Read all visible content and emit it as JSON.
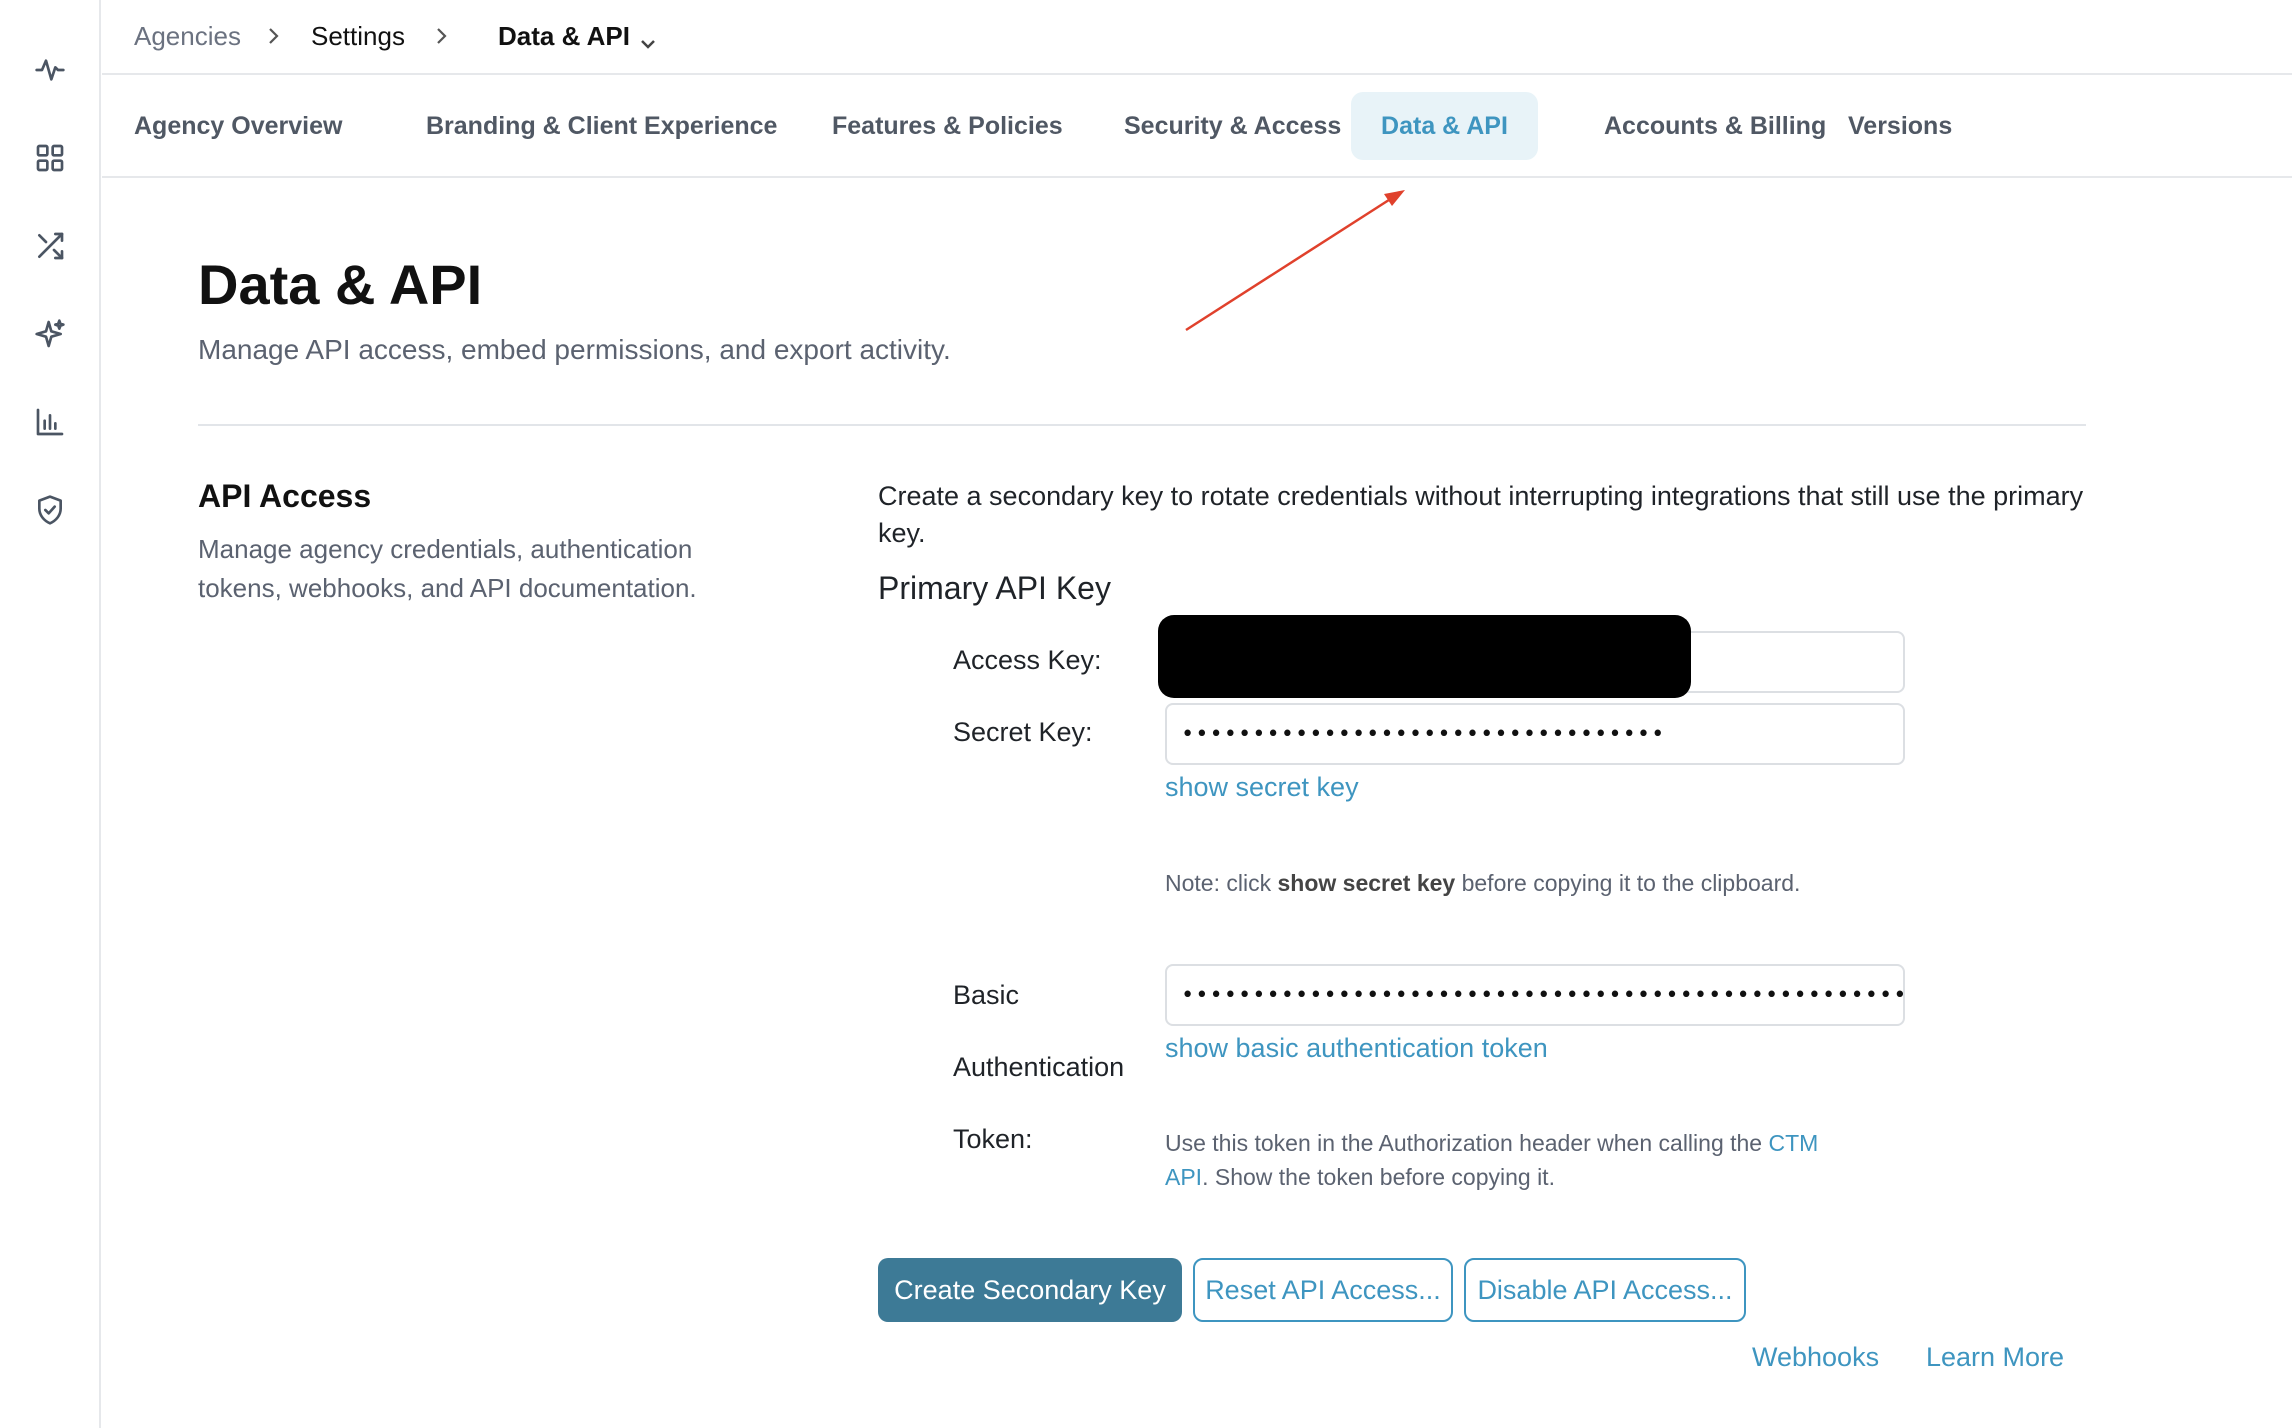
{
  "breadcrumb": {
    "items": [
      "Agencies",
      "Settings"
    ],
    "current": "Data & API"
  },
  "tabs": [
    {
      "label": "Agency Overview",
      "active": false
    },
    {
      "label": "Branding & Client Experience",
      "active": false
    },
    {
      "label": "Features & Policies",
      "active": false
    },
    {
      "label": "Security & Access",
      "active": false
    },
    {
      "label": "Data & API",
      "active": true
    },
    {
      "label": "Accounts & Billing",
      "active": false
    },
    {
      "label": "Versions",
      "active": false
    }
  ],
  "rail": {
    "icons": [
      "activity-icon",
      "grid-icon",
      "shuffle-icon",
      "sparkle-icon",
      "bar-chart-icon",
      "shield-icon"
    ]
  },
  "page": {
    "title": "Data & API",
    "subtitle": "Manage API access, embed permissions, and export activity."
  },
  "section": {
    "title": "API Access",
    "description": "Manage agency credentials, authentication tokens, webhooks, and API documentation."
  },
  "api": {
    "intro": "Create a secondary key to rotate credentials without interrupting integrations that still use the primary key.",
    "primary_heading": "Primary API Key",
    "access_key_label": "Access Key:",
    "access_key_value": "",
    "secret_key_label": "Secret Key:",
    "secret_key_value": "••••••••••••••••••••••••••••••••••",
    "show_secret_link": "show secret key",
    "note_prefix": "Note: click ",
    "note_bold": "show secret key",
    "note_suffix": " before copying it to the clipboard.",
    "basic_label_1": "Basic",
    "basic_label_2": "Authentication",
    "basic_label_3": "Token:",
    "basic_token_value": "••••••••••••••••••••••••••••••••••••••••••••••••••••••••••••••••••••••••••••••••••",
    "show_basic_link": "show basic authentication token",
    "token_note_prefix": "Use this token in the Authorization header when calling the ",
    "token_note_link_1": "CTM",
    "token_note_link_2": "API",
    "token_note_suffix": ". Show the token before copying it."
  },
  "buttons": {
    "create_secondary": "Create Secondary Key",
    "reset": "Reset API Access...",
    "disable": "Disable API Access..."
  },
  "footer_links": {
    "webhooks": "Webhooks",
    "learn_more": "Learn More"
  },
  "colors": {
    "accent": "#3e95c0",
    "primary_button": "#3d7a96",
    "active_tab_bg": "#e8f3f8",
    "annotation_arrow": "#e0412c"
  }
}
